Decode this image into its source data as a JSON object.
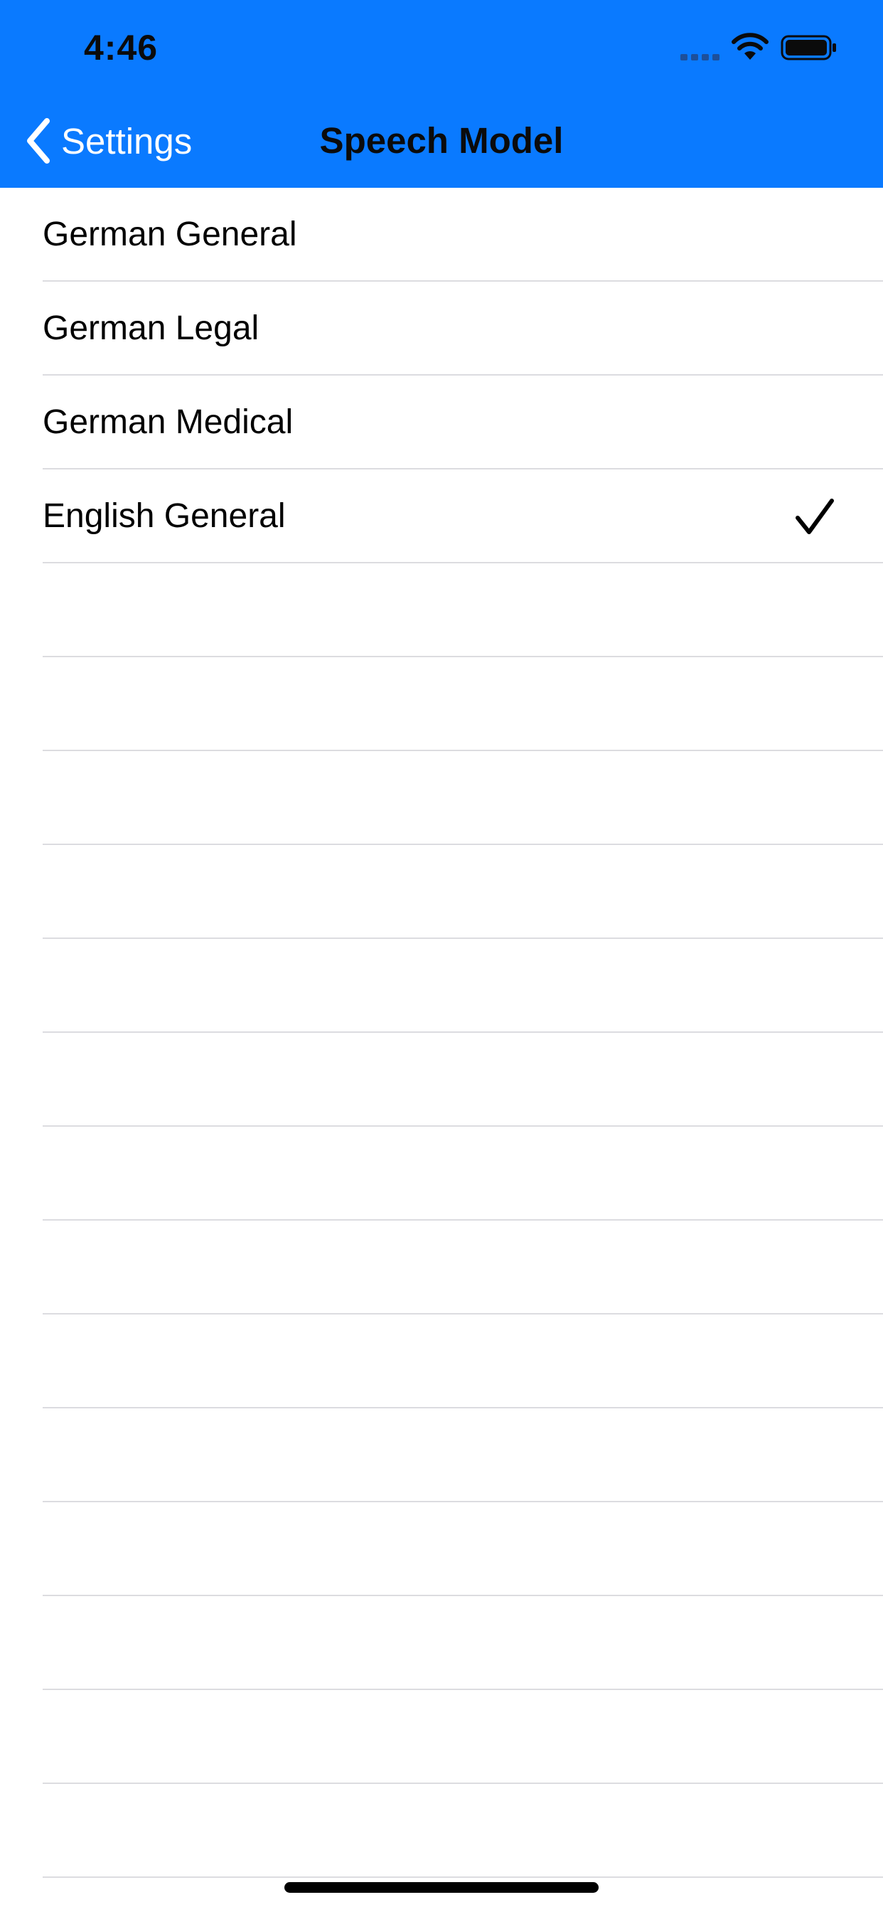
{
  "status_bar": {
    "time": "4:46",
    "icons": [
      "cellular-signal-icon",
      "wifi-icon",
      "battery-icon"
    ]
  },
  "nav": {
    "back_label": "Settings",
    "title": "Speech Model",
    "back_icon": "chevron-left-icon"
  },
  "models": [
    {
      "label": "German General",
      "selected": false
    },
    {
      "label": "German Legal",
      "selected": false
    },
    {
      "label": "German Medical",
      "selected": false
    },
    {
      "label": "English General",
      "selected": true
    }
  ],
  "empty_rows": 14,
  "colors": {
    "header_bg": "#0a7aff",
    "back_text": "#ffffff",
    "title_text": "#0b0b0b",
    "separator": "#dcdce0",
    "background": "#ffffff"
  }
}
